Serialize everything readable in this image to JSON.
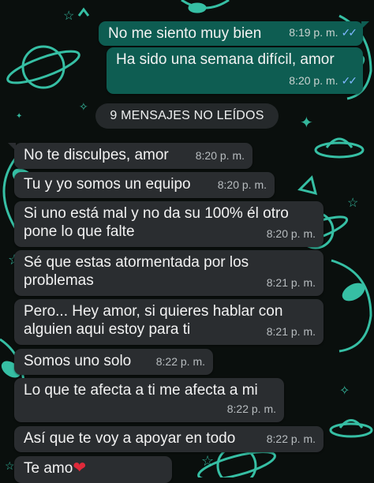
{
  "colors": {
    "outgoing_bubble": "#0e5d52",
    "incoming_bubble": "#2a2d30",
    "read_ticks": "#7fb7ff",
    "wallpaper_glow": "#3fe0c0"
  },
  "unread_banner": "9 MENSAJES NO LEÍDOS",
  "outgoing": [
    {
      "text": "No me siento muy bien",
      "time": "8:19 p. m.",
      "status_icon": "double-check-icon"
    },
    {
      "text": "Ha sido una semana difícil, amor",
      "time": "8:20 p. m.",
      "status_icon": "double-check-icon"
    }
  ],
  "incoming": [
    {
      "text": "No te disculpes, amor",
      "time": "8:20 p. m."
    },
    {
      "text": "Tu y yo somos un equipo",
      "time": "8:20 p. m."
    },
    {
      "text": "Si uno está mal y no da su 100% él otro\npone lo que falte",
      "time": "8:20 p. m."
    },
    {
      "text": "Sé que estas atormentada por los\nproblemas",
      "time": "8:21 p. m."
    },
    {
      "text": "Pero... Hey amor, si quieres hablar con\nalguien aqui estoy para ti",
      "time": "8:21 p. m."
    },
    {
      "text": "Somos uno solo",
      "time": "8:22 p. m."
    },
    {
      "text": "Lo que te afecta a ti me afecta a mi",
      "time": "8:22 p. m."
    },
    {
      "text": "Así que te voy a apoyar en todo",
      "time": "8:22 p. m."
    },
    {
      "text": "Te amo",
      "time": "",
      "emoji": "❤"
    }
  ]
}
